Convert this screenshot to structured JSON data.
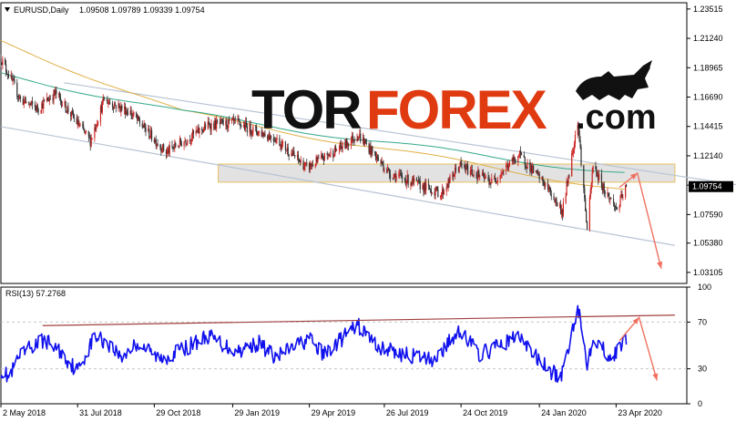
{
  "chart_data": [
    {
      "type": "candlestick",
      "title": "EURUSD,Daily",
      "ohlc_text": "1.09508 1.09789 1.09339 1.09754",
      "last_price_label": "1.09754",
      "last_price": 1.09754,
      "ylim": [
        1.0225,
        1.24
      ],
      "y_ticks": [
        1.23515,
        1.2124,
        1.18965,
        1.1669,
        1.14415,
        1.1214,
        1.09865,
        1.0759,
        1.0538,
        1.03105
      ],
      "y_tick_labels": [
        "1.23515",
        "1.21240",
        "1.18965",
        "1.16690",
        "1.14415",
        "1.12140",
        "1.09865",
        "1.07590",
        "1.05380",
        "1.03105"
      ],
      "price_path_nodes": [
        [
          "2018-05-02",
          1.197
        ],
        [
          "2018-05-25",
          1.165
        ],
        [
          "2018-06-14",
          1.158
        ],
        [
          "2018-07-05",
          1.17
        ],
        [
          "2018-08-15",
          1.133
        ],
        [
          "2018-08-31",
          1.165
        ],
        [
          "2018-10-01",
          1.155
        ],
        [
          "2018-11-12",
          1.124
        ],
        [
          "2018-12-31",
          1.145
        ],
        [
          "2019-02-01",
          1.147
        ],
        [
          "2019-03-20",
          1.135
        ],
        [
          "2019-04-26",
          1.112
        ],
        [
          "2019-06-10",
          1.13
        ],
        [
          "2019-06-25",
          1.138
        ],
        [
          "2019-08-01",
          1.108
        ],
        [
          "2019-10-01",
          1.092
        ],
        [
          "2019-10-22",
          1.114
        ],
        [
          "2019-11-29",
          1.101
        ],
        [
          "2019-12-31",
          1.122
        ],
        [
          "2020-01-31",
          1.099
        ],
        [
          "2020-02-20",
          1.078
        ],
        [
          "2020-03-09",
          1.149
        ],
        [
          "2020-03-20",
          1.064
        ],
        [
          "2020-03-27",
          1.114
        ],
        [
          "2020-04-10",
          1.094
        ],
        [
          "2020-04-24",
          1.08
        ],
        [
          "2020-05-05",
          1.0975
        ]
      ],
      "moving_averages": [
        {
          "color": "#e0b048",
          "values": [
            [
              "2018-05-02",
              1.21
            ],
            [
              "2018-12-01",
              1.155
            ],
            [
              "2019-06-01",
              1.133
            ],
            [
              "2019-12-01",
              1.112
            ],
            [
              "2020-05-05",
              1.095
            ]
          ]
        },
        {
          "color": "#33a889",
          "values": [
            [
              "2018-05-02",
              1.185
            ],
            [
              "2018-12-01",
              1.155
            ],
            [
              "2019-06-01",
              1.137
            ],
            [
              "2019-12-01",
              1.12
            ],
            [
              "2020-05-05",
              1.108
            ]
          ]
        }
      ],
      "trend_channel": {
        "upper": [
          [
            "2018-07-15",
            1.178
          ],
          [
            "2020-10-01",
            1.097
          ]
        ],
        "lower": [
          [
            "2018-05-02",
            1.144
          ],
          [
            "2020-07-01",
            1.052
          ]
        ]
      },
      "resistance_zone": {
        "x_start": "2019-01-12",
        "x_end": "2020-07-01",
        "y_low": 1.101,
        "y_high": 1.115
      },
      "forecast_path": [
        [
          "2020-04-27",
          1.097
        ],
        [
          "2020-05-18",
          1.108
        ],
        [
          "2020-06-15",
          1.034
        ]
      ]
    },
    {
      "type": "line",
      "title": "RSI(13) 57.2768",
      "ylim": [
        0,
        100
      ],
      "y_ticks": [
        100,
        70,
        30,
        0
      ],
      "y_tick_labels": [
        "100",
        "70",
        "30",
        "0"
      ],
      "levels": [
        70,
        30
      ],
      "rsi_path_nodes": [
        [
          "2018-05-02",
          29
        ],
        [
          "2018-05-12",
          22
        ],
        [
          "2018-05-22",
          38
        ],
        [
          "2018-06-05",
          48
        ],
        [
          "2018-06-22",
          55
        ],
        [
          "2018-07-10",
          45
        ],
        [
          "2018-07-31",
          28
        ],
        [
          "2018-08-20",
          58
        ],
        [
          "2018-09-05",
          52
        ],
        [
          "2018-09-20",
          40
        ],
        [
          "2018-10-10",
          52
        ],
        [
          "2018-11-05",
          38
        ],
        [
          "2018-12-05",
          48
        ],
        [
          "2018-12-31",
          58
        ],
        [
          "2019-02-01",
          45
        ],
        [
          "2019-03-01",
          52
        ],
        [
          "2019-03-20",
          40
        ],
        [
          "2019-04-29",
          56
        ],
        [
          "2019-05-15",
          42
        ],
        [
          "2019-06-10",
          58
        ],
        [
          "2019-06-25",
          67
        ],
        [
          "2019-07-20",
          48
        ],
        [
          "2019-08-20",
          42
        ],
        [
          "2019-09-20",
          38
        ],
        [
          "2019-10-01",
          44
        ],
        [
          "2019-10-22",
          64
        ],
        [
          "2019-11-15",
          42
        ],
        [
          "2019-12-31",
          58
        ],
        [
          "2020-01-20",
          40
        ],
        [
          "2020-02-05",
          28
        ],
        [
          "2020-02-19",
          22
        ],
        [
          "2020-03-09",
          85
        ],
        [
          "2020-03-20",
          35
        ],
        [
          "2020-03-27",
          58
        ],
        [
          "2020-04-10",
          45
        ],
        [
          "2020-04-20",
          40
        ],
        [
          "2020-05-05",
          57
        ]
      ],
      "trend_line": [
        [
          "2018-06-20",
          67
        ],
        [
          "2020-07-01",
          76
        ]
      ],
      "forecast_path": [
        [
          "2020-04-27",
          54
        ],
        [
          "2020-05-20",
          74
        ],
        [
          "2020-06-10",
          20
        ]
      ]
    }
  ],
  "x_axis": {
    "start_date": "2018-05-02",
    "end_date": "2020-07-15",
    "ticks": [
      "2018-05-02",
      "2018-07-31",
      "2018-10-29",
      "2019-01-29",
      "2019-04-29",
      "2019-07-26",
      "2019-10-24",
      "2020-01-24",
      "2020-04-23"
    ],
    "tick_labels": [
      "2 May 2018",
      "31 Jul 2018",
      "29 Oct 2018",
      "29 Jan 2019",
      "29 Apr 2019",
      "26 Jul 2019",
      "24 Oct 2019",
      "24 Jan 2020",
      "23 Apr 2020"
    ]
  },
  "watermark": {
    "part1": "TOR",
    "part2": "FOREX",
    "part3": ".com"
  },
  "colors": {
    "bull_candle": "#cc2020",
    "bear_candle": "#333333",
    "rsi_line": "#1010ee",
    "forecast": "#f07060",
    "channel": "#b8c4d4",
    "zone": "#d8d8d8",
    "rsi_trend": "#a04040",
    "grid": "#c8c8c8",
    "price_tag": "#000000",
    "watermark_dark": "#111111",
    "watermark_accent": "#e03a10"
  }
}
